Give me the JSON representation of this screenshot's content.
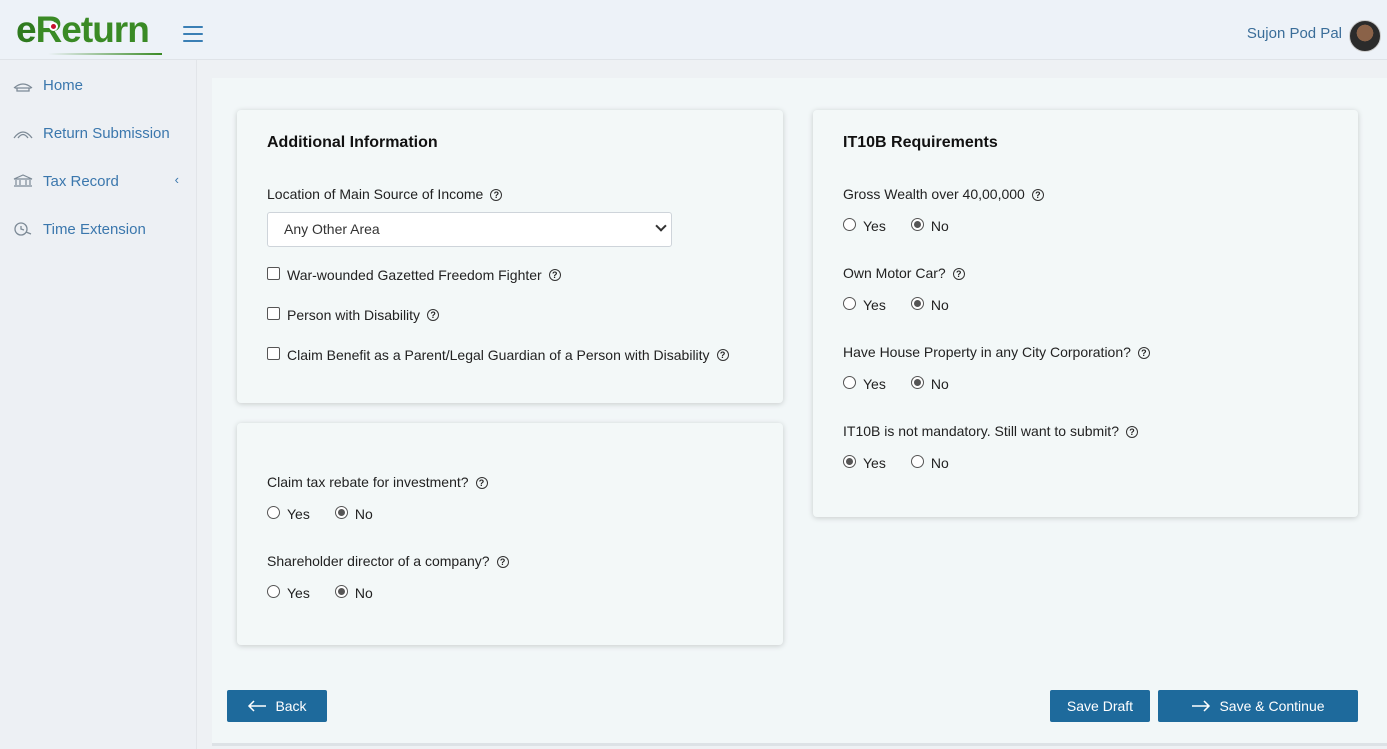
{
  "header": {
    "logo_e": "e",
    "logo_rest": "Return",
    "user_name": "Sujon Pod Pal"
  },
  "sidebar": {
    "items": [
      {
        "label": "Home",
        "icon": "home-icon"
      },
      {
        "label": "Return Submission",
        "icon": "return-icon"
      },
      {
        "label": "Tax Record",
        "icon": "bank-icon",
        "chevron": "‹"
      },
      {
        "label": "Time Extension",
        "icon": "clock-icon"
      }
    ]
  },
  "additional_info": {
    "title": "Additional Information",
    "location_label": "Location of Main Source of Income",
    "location_value": "Any Other Area",
    "checkboxes": [
      "War-wounded Gazetted Freedom Fighter",
      "Person with Disability",
      "Claim Benefit as a Parent/Legal Guardian of a Person with Disability"
    ]
  },
  "investment": {
    "q1": "Claim tax rebate for investment?",
    "q2": "Shareholder director of a company?"
  },
  "it10b": {
    "title": "IT10B Requirements",
    "q1": "Gross Wealth over 40,00,000",
    "q2": "Own Motor Car?",
    "q3": "Have House Property in any City Corporation?",
    "q4": "IT10B is not mandatory. Still want to submit?"
  },
  "options": {
    "yes": "Yes",
    "no": "No",
    "help": "?"
  },
  "buttons": {
    "back": "Back",
    "save_draft": "Save Draft",
    "save_continue": "Save & Continue"
  },
  "colors": {
    "primary": "#1e6a9c",
    "link": "#3b77ad",
    "logo_green": "#3a8a25"
  }
}
